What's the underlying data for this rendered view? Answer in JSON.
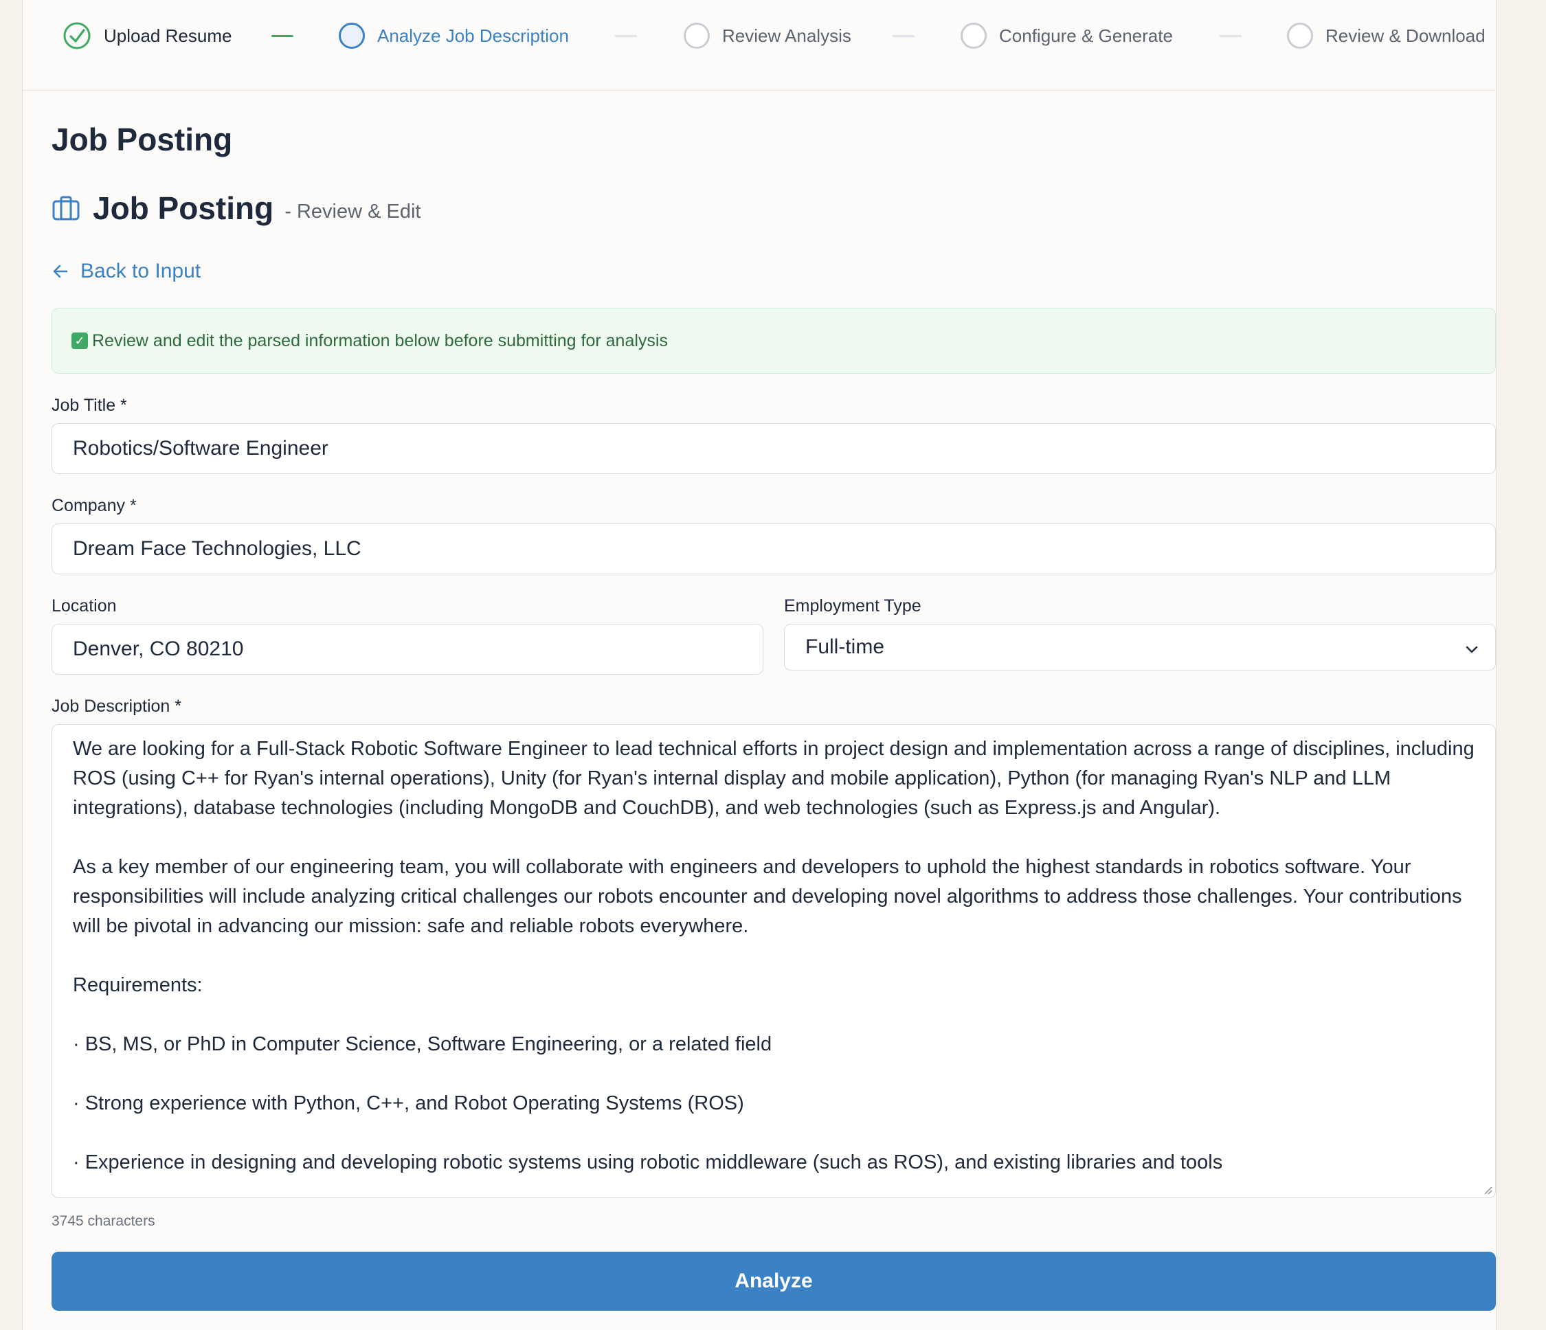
{
  "stepper": {
    "steps": [
      {
        "label": "Upload Resume",
        "state": "done"
      },
      {
        "label": "Analyze Job Description",
        "state": "active"
      },
      {
        "label": "Review Analysis",
        "state": "pending"
      },
      {
        "label": "Configure & Generate",
        "state": "pending"
      },
      {
        "label": "Review & Download",
        "state": "pending"
      }
    ]
  },
  "page": {
    "title": "Job Posting",
    "section_title": "Job Posting",
    "section_note": "- Review & Edit",
    "back_label": "Back to Input"
  },
  "alert": {
    "text": "Review and edit the parsed information below before submitting for analysis"
  },
  "form": {
    "job_title_label": "Job Title *",
    "job_title_value": "Robotics/Software Engineer",
    "company_label": "Company *",
    "company_value": "Dream Face Technologies, LLC",
    "location_label": "Location",
    "location_value": "Denver, CO 80210",
    "employment_label": "Employment Type",
    "employment_value": "Full-time",
    "description_label": "Job Description *",
    "description_paragraphs": [
      "We are looking for a Full-Stack Robotic Software Engineer to lead technical efforts in project design and implementation across a range of disciplines, including ROS (using C++ for Ryan's internal operations), Unity (for Ryan's internal display and mobile application), Python (for managing Ryan's NLP and LLM integrations), database technologies (including MongoDB and CouchDB), and web technologies (such as Express.js and Angular).",
      "As a key member of our engineering team, you will collaborate with engineers and developers to uphold the highest standards in robotics software. Your responsibilities will include analyzing critical challenges our robots encounter and developing novel algorithms to address those challenges. Your contributions will be pivotal in advancing our mission: safe and reliable robots everywhere.",
      "Requirements:",
      "· BS, MS, or PhD in Computer Science, Software Engineering, or a related field",
      "· Strong experience with Python, C++, and Robot Operating Systems (ROS)",
      "· Experience in designing and developing robotic systems using robotic middleware (such as ROS), and existing libraries and tools"
    ],
    "char_count": "3745 characters",
    "analyze_label": "Analyze"
  },
  "colors": {
    "accent": "#3b82c4",
    "success": "#3fa865",
    "alert_bg": "#eefaf0"
  }
}
